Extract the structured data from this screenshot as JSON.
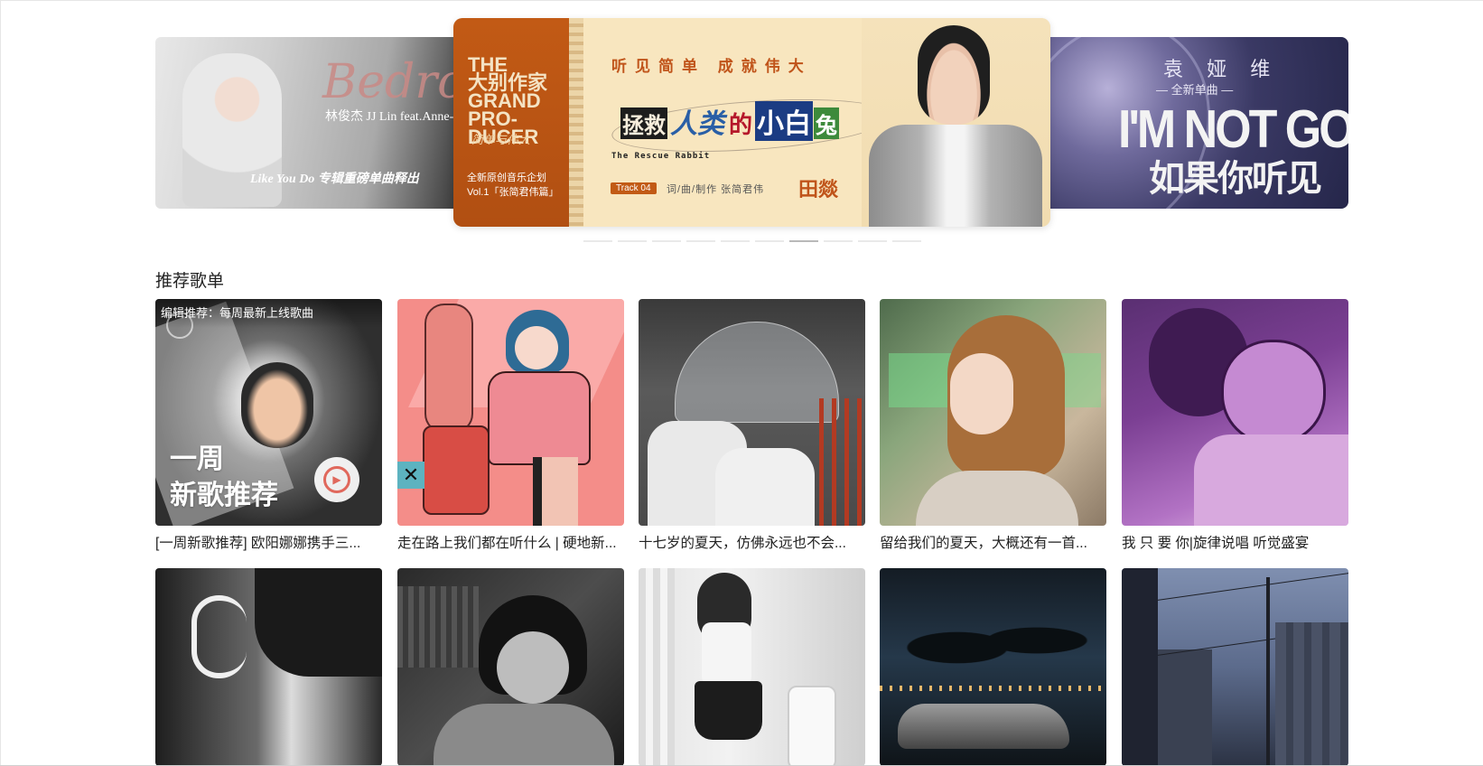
{
  "banners": {
    "left": {
      "script": "Bedroo",
      "artist": "林俊杰  JJ Lin feat.Anne-M",
      "subtitle": "Like You Do 专辑重磅单曲释出"
    },
    "center": {
      "logo": "THE\n大别作家\nGRAND\nPRO-\nDUCER",
      "logo_sub": "简单与伟大",
      "desc_line1": "全新原创音乐企划",
      "desc_line2": "Vol.1「张简君伟篇」",
      "slogan": "听见简单  成就伟大",
      "song_parts": [
        "拯救",
        "人类",
        "的",
        "小白",
        "兔"
      ],
      "song_en": "The Rescue Rabbit",
      "track": "Track 04",
      "credit": "词/曲/制作  张简君伟",
      "singer": "田燚"
    },
    "right": {
      "artist": "袁 娅 维",
      "tag": "— 全新单曲 —",
      "title_en": "I'M NOT GOOD",
      "title_cn": "如果你听见"
    }
  },
  "carousel": {
    "dot_count": 10,
    "active_index": 6
  },
  "section": {
    "title": "推荐歌单"
  },
  "playlists_row1": [
    {
      "caption": "[一周新歌推荐] 欧阳娜娜携手三...",
      "overlay_label": "编辑推荐：每周最新上线歌曲",
      "overlay_big_line1": "一周",
      "overlay_big_line2": "新歌推荐"
    },
    {
      "caption": "走在路上我们都在听什么 | 硬地新..."
    },
    {
      "caption": "十七岁的夏天，仿佛永远也不会..."
    },
    {
      "caption": "留给我们的夏天，大概还有一首..."
    },
    {
      "caption": "我 只 要 你|旋律说唱 听觉盛宴"
    }
  ],
  "colors": {
    "accent": "#c25a15",
    "text": "#222222",
    "play_icon": "#e0685c"
  }
}
